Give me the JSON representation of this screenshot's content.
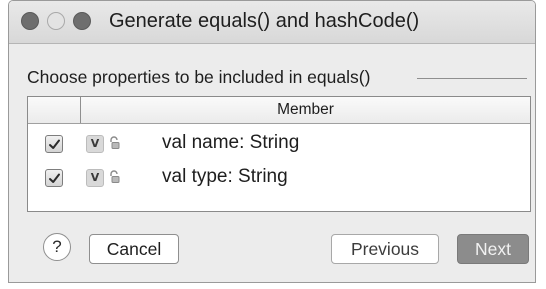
{
  "window": {
    "title": "Generate equals() and hashCode()"
  },
  "section": {
    "label": "Choose properties to be included in equals()"
  },
  "table": {
    "column_header": "Member",
    "rows": [
      {
        "checked": true,
        "badge": "V",
        "label": "val name: String"
      },
      {
        "checked": true,
        "badge": "V",
        "label": "val type: String"
      }
    ]
  },
  "buttons": {
    "help": "?",
    "cancel": "Cancel",
    "previous": "Previous",
    "next": "Next"
  },
  "icons": {
    "row_icon": "lock-icon",
    "check_icon": "checkmark-icon"
  }
}
